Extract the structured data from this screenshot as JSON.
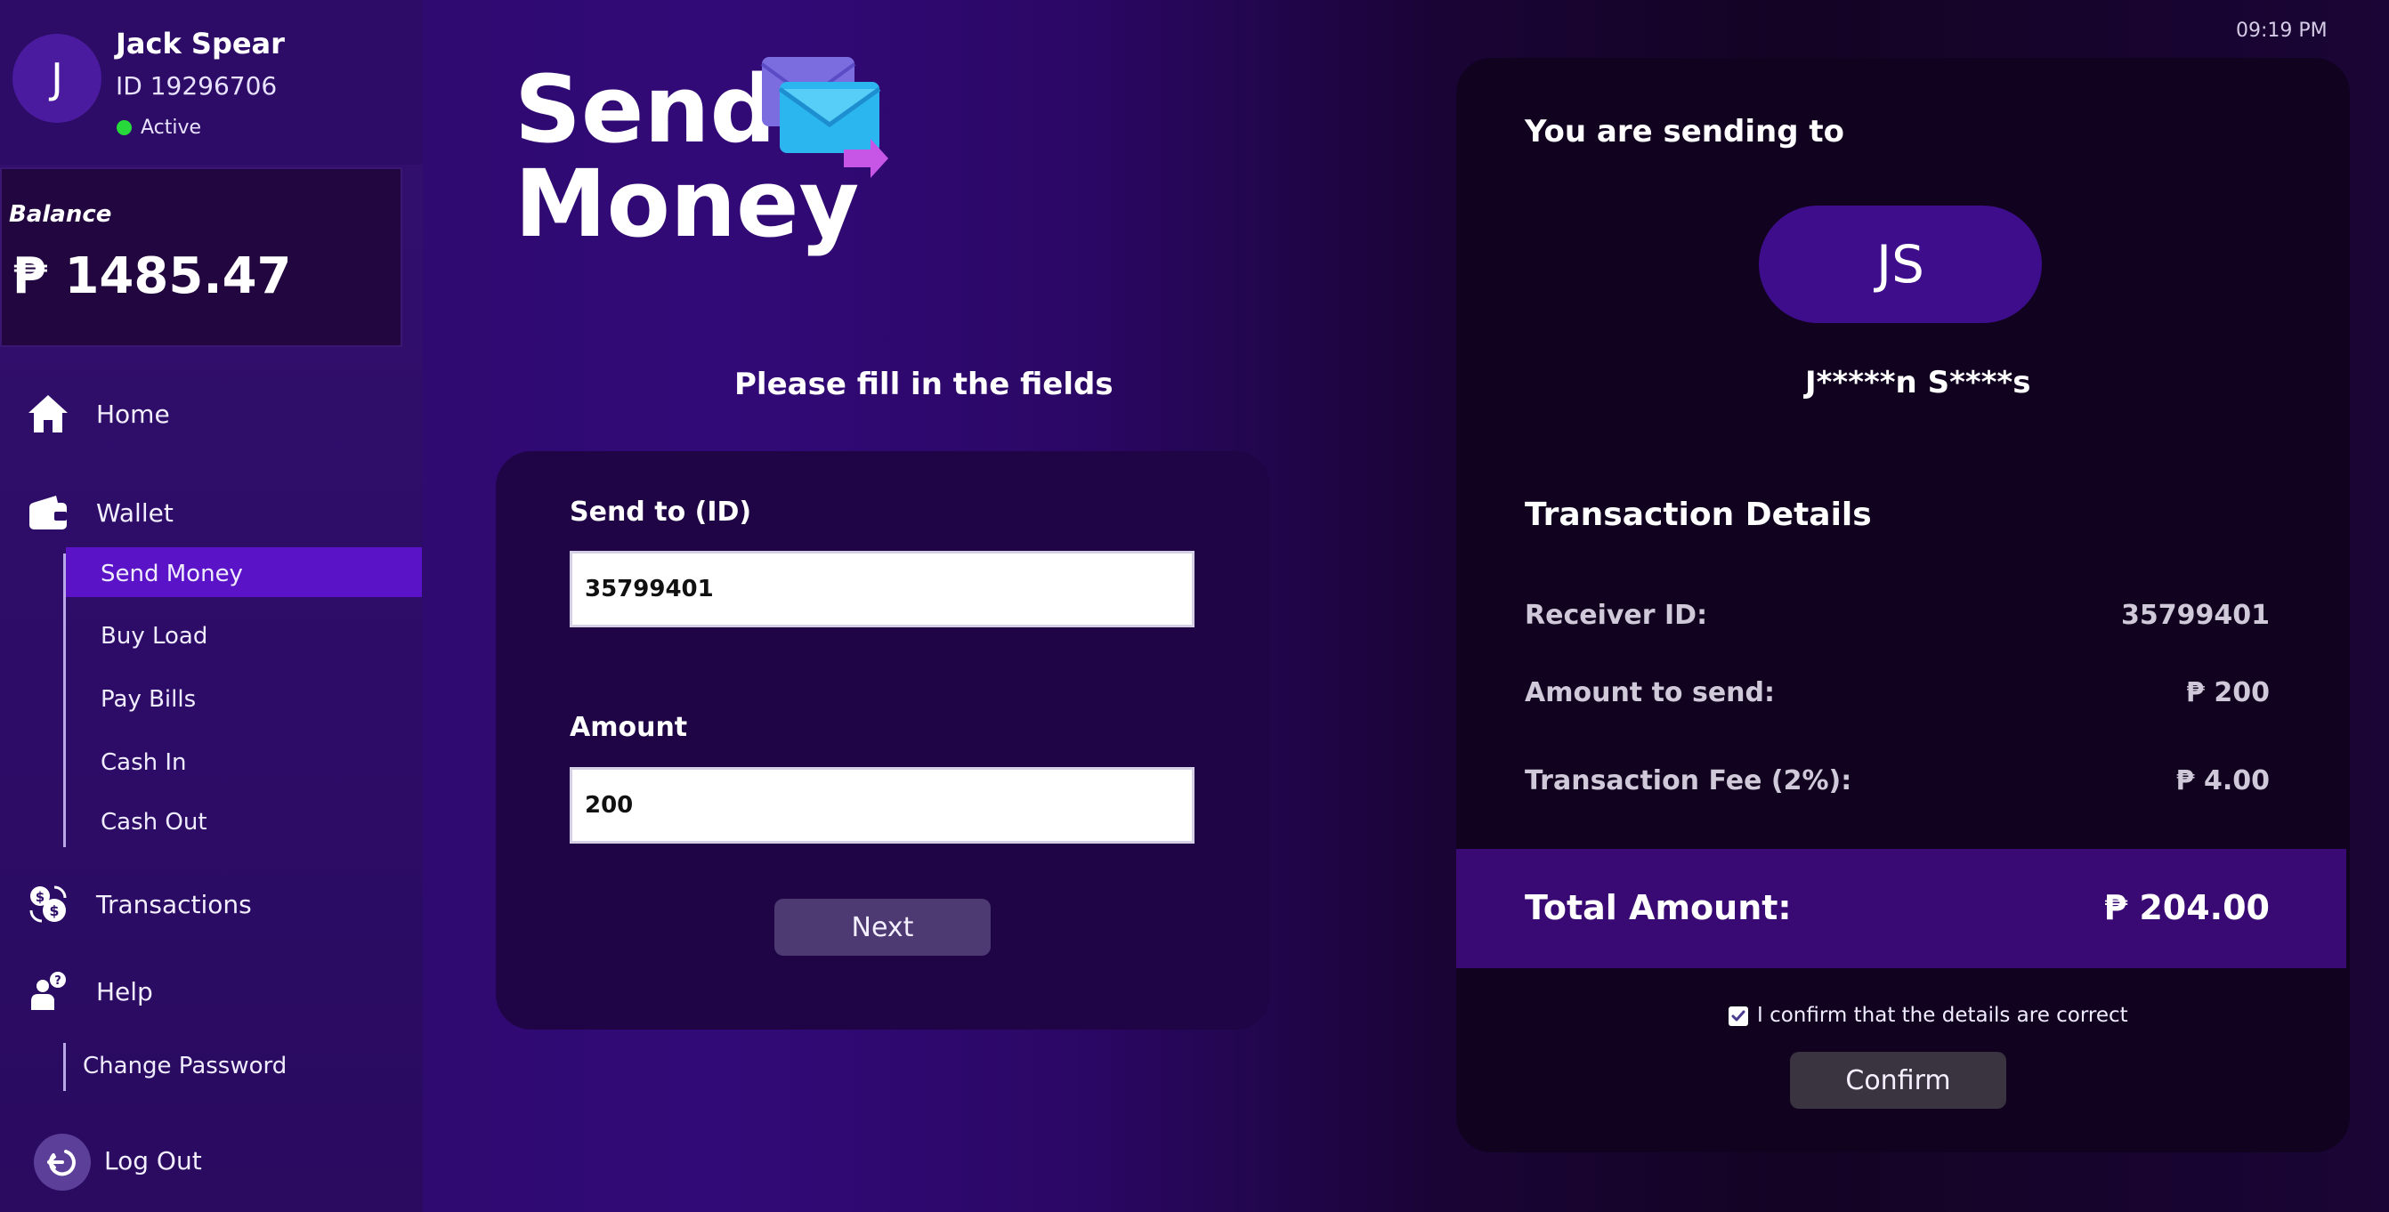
{
  "profile": {
    "initial": "J",
    "name": "Jack Spear",
    "id_text": "ID 19296706",
    "status": "Active",
    "status_color": "#27d93a"
  },
  "balance": {
    "label": "Balance",
    "value": "₱ 1485.47"
  },
  "nav": {
    "home": "Home",
    "wallet": "Wallet",
    "wallet_items": [
      "Send Money",
      "Buy Load",
      "Pay Bills",
      "Cash In",
      "Cash Out"
    ],
    "active_item": "Send Money",
    "transactions": "Transactions",
    "help": "Help",
    "help_items": [
      "Change Password"
    ],
    "logout": "Log Out"
  },
  "page": {
    "title_line1": "Send",
    "title_line2": "Money",
    "title_icon": "envelope-send-icon",
    "instruction": "Please fill in the fields"
  },
  "form": {
    "send_to_label": "Send to (ID)",
    "send_to_value": "35799401",
    "amount_label": "Amount",
    "amount_value": "200",
    "next_label": "Next"
  },
  "clock": "09:19 PM",
  "summary": {
    "sending_to_label": "You are sending to",
    "recipient_initials": "JS",
    "recipient_masked": "J*****n S****s",
    "details_title": "Transaction Details",
    "rows": [
      {
        "label": "Receiver ID:",
        "value": "35799401"
      },
      {
        "label": "Amount to send:",
        "value": "₱ 200"
      },
      {
        "label": "Transaction Fee (2%):",
        "value": "₱ 4.00"
      }
    ],
    "total_label": "Total Amount:",
    "total_value": "₱ 204.00",
    "confirm_checkbox_text": "I confirm that the details are correct",
    "confirm_checked": true,
    "confirm_button": "Confirm"
  },
  "colors": {
    "accent": "#5a13c6",
    "total_bar": "#3a0a74",
    "panel": "#11021f"
  }
}
